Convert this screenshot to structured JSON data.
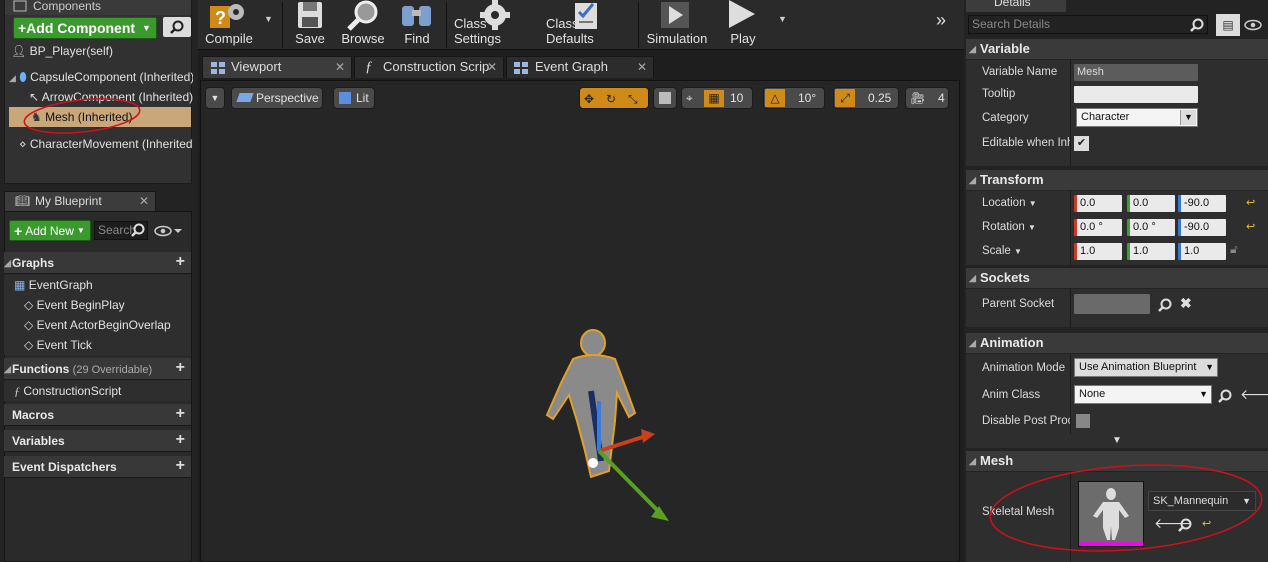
{
  "components_panel": {
    "tab_title": "Components",
    "add_button": "+Add Component",
    "tree": [
      {
        "label": "BP_Player(self)"
      },
      {
        "label": "CapsuleComponent (Inherited)"
      },
      {
        "label": "ArrowComponent (Inherited)"
      },
      {
        "label": "Mesh (Inherited)"
      },
      {
        "label": "CharacterMovement (Inherited)"
      }
    ]
  },
  "my_blueprint": {
    "tab_title": "My Blueprint",
    "add_new": "Add New",
    "search_placeholder": "Search",
    "graphs_header": "Graphs",
    "graphs": [
      "EventGraph",
      "Event BeginPlay",
      "Event ActorBeginOverlap",
      "Event Tick"
    ],
    "functions_header": "Functions",
    "functions_count": "(29 Overridable)",
    "functions": [
      "ConstructionScript"
    ],
    "macros_header": "Macros",
    "variables_header": "Variables",
    "dispatchers_header": "Event Dispatchers"
  },
  "toolbar": {
    "compile": "Compile",
    "save": "Save",
    "browse": "Browse",
    "find": "Find",
    "class_settings": "Class Settings",
    "class_defaults": "Class Defaults",
    "simulation": "Simulation",
    "play": "Play"
  },
  "doc_tabs": {
    "viewport": "Viewport",
    "construction": "Construction Scrip",
    "event_graph": "Event Graph"
  },
  "viewport": {
    "perspective": "Perspective",
    "lit": "Lit",
    "grid_snap": "10",
    "rot_snap": "10°",
    "scale_snap": "0.25",
    "camera_speed": "4"
  },
  "details": {
    "tab_title": "Details",
    "search_placeholder": "Search Details",
    "variable": {
      "header": "Variable",
      "name_label": "Variable Name",
      "name_value": "Mesh",
      "tooltip_label": "Tooltip",
      "tooltip_value": "",
      "category_label": "Category",
      "category_value": "Character",
      "editable_label": "Editable when Inh"
    },
    "transform": {
      "header": "Transform",
      "location_label": "Location",
      "rotation_label": "Rotation",
      "scale_label": "Scale",
      "location": [
        "0.0",
        "0.0",
        "-90.0"
      ],
      "rotation": [
        "0.0 °",
        "0.0 °",
        "-90.0"
      ],
      "scale": [
        "1.0",
        "1.0",
        "1.0"
      ]
    },
    "sockets": {
      "header": "Sockets",
      "parent_label": "Parent Socket",
      "parent_value": ""
    },
    "animation": {
      "header": "Animation",
      "mode_label": "Animation Mode",
      "mode_value": "Use Animation Blueprint",
      "class_label": "Anim Class",
      "class_value": "None",
      "disable_label": "Disable Post Proc"
    },
    "mesh": {
      "header": "Mesh",
      "skeletal_label": "Skeletal Mesh",
      "skeletal_value": "SK_Mannequin"
    }
  },
  "colors": {
    "accent_green": "#3a9a2e",
    "selection": "#c9a77a",
    "orange": "#d08a17",
    "annotation_red": "#d0101a"
  }
}
